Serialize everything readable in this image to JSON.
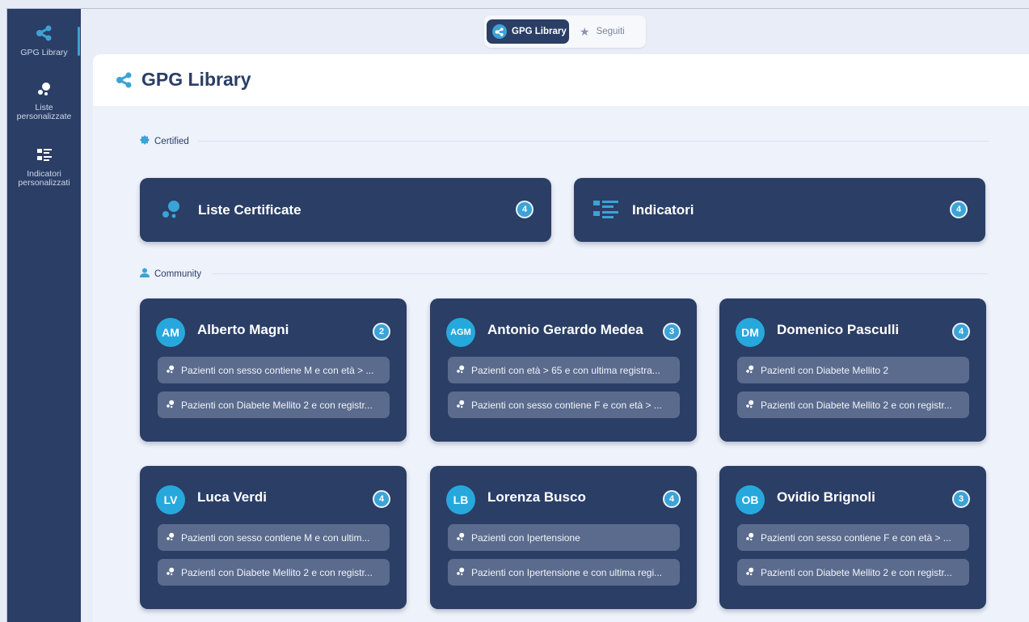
{
  "sidebar": {
    "items": [
      {
        "label": "GPG Library",
        "icon": "share-icon"
      },
      {
        "label": "Liste personalizzate",
        "icon": "bubbles-icon"
      },
      {
        "label": "Indicatori personalizzati",
        "icon": "list-icon"
      }
    ]
  },
  "tabs": [
    {
      "label": "GPG Library",
      "icon": "share-icon",
      "active": true
    },
    {
      "label": "Seguiti",
      "icon": "star-icon",
      "active": false
    }
  ],
  "main": {
    "title": "GPG Library",
    "certified": {
      "label": "Certified",
      "cards": [
        {
          "title": "Liste Certificate",
          "count": "4",
          "icon": "bubbles-icon"
        },
        {
          "title": "Indicatori",
          "count": "4",
          "icon": "list-icon"
        }
      ]
    },
    "community": {
      "label": "Community",
      "authors": [
        {
          "initials": "AM",
          "name": "Alberto Magni",
          "count": "2",
          "items": [
            "Pazienti con sesso contiene M e con età > ...",
            "Pazienti con Diabete Mellito 2 e con registr..."
          ]
        },
        {
          "initials": "AGM",
          "name": "Antonio Gerardo Medea",
          "count": "3",
          "items": [
            "Pazienti con età > 65 e con ultima registra...",
            "Pazienti con sesso contiene F e con età > ..."
          ]
        },
        {
          "initials": "DM",
          "name": "Domenico Pasculli",
          "count": "4",
          "items": [
            "Pazienti con Diabete Mellito 2",
            "Pazienti con Diabete Mellito 2 e con registr..."
          ]
        },
        {
          "initials": "LV",
          "name": "Luca Verdi",
          "count": "4",
          "items": [
            "Pazienti con sesso contiene M e con ultim...",
            "Pazienti con Diabete Mellito 2 e con registr..."
          ]
        },
        {
          "initials": "LB",
          "name": "Lorenza Busco",
          "count": "4",
          "items": [
            "Pazienti con Ipertensione",
            "Pazienti con Ipertensione e con ultima regi..."
          ]
        },
        {
          "initials": "OB",
          "name": "Ovidio Brignoli",
          "count": "3",
          "items": [
            "Pazienti con sesso contiene F e con età > ...",
            "Pazienti con Diabete Mellito 2 e con registr..."
          ]
        }
      ]
    }
  },
  "colors": {
    "navy": "#2a3e66",
    "accent": "#3ba3d6",
    "avatar": "#27a8dc",
    "item_bg": "#5a6b8d",
    "background": "#eef2fb"
  }
}
